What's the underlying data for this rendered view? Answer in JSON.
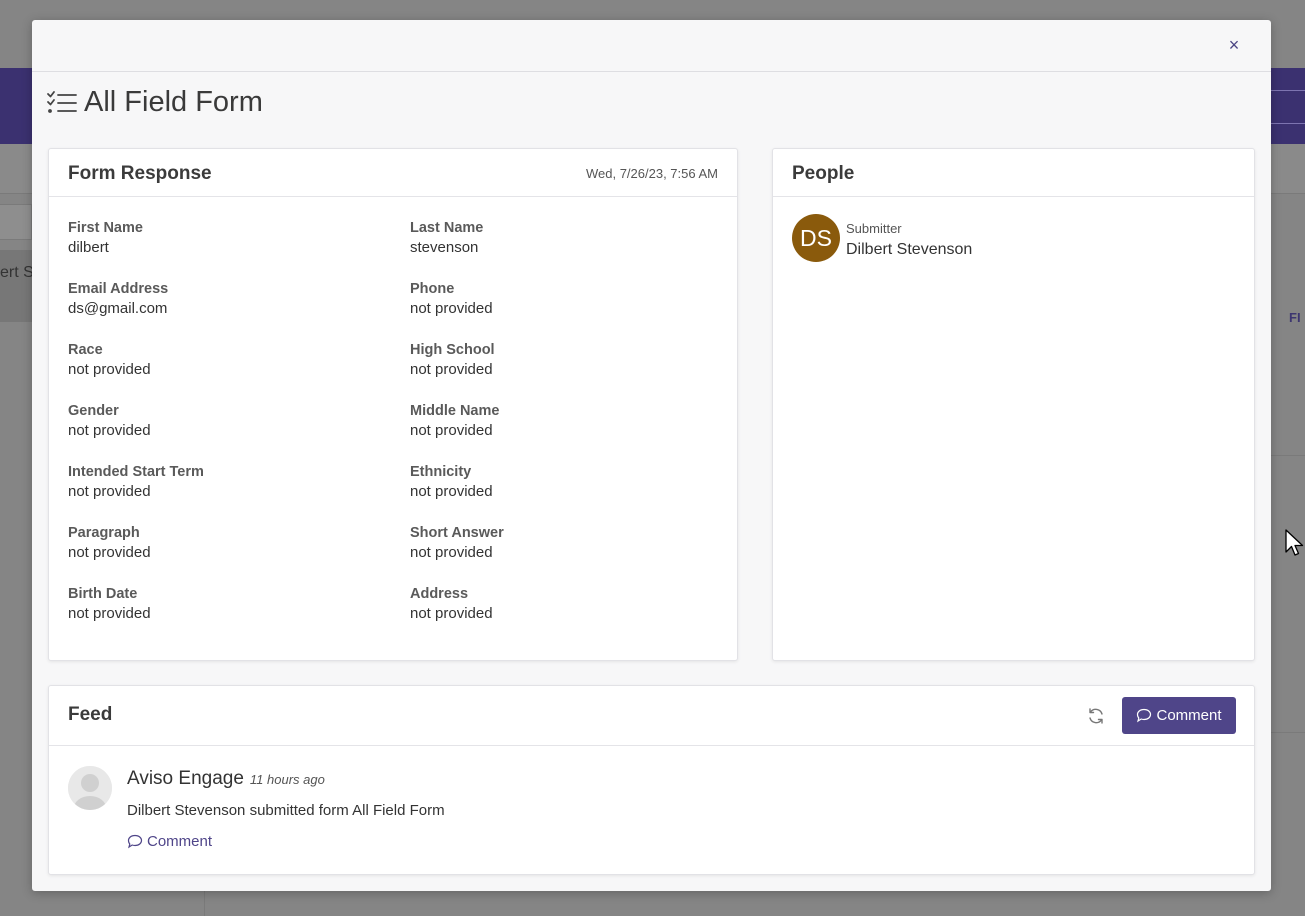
{
  "background": {
    "left_item_text": "ert S",
    "right_fi_text": "FI"
  },
  "modal": {
    "close_label": "×",
    "title": "All Field Form"
  },
  "form_response": {
    "title": "Form Response",
    "date": "Wed, 7/26/23, 7:56 AM",
    "fields": [
      {
        "label": "First Name",
        "value": "dilbert"
      },
      {
        "label": "Last Name",
        "value": "stevenson"
      },
      {
        "label": "Email Address",
        "value": "ds@gmail.com"
      },
      {
        "label": "Phone",
        "value": "not provided"
      },
      {
        "label": "Race",
        "value": "not provided"
      },
      {
        "label": "High School",
        "value": "not provided"
      },
      {
        "label": "Gender",
        "value": "not provided"
      },
      {
        "label": "Middle Name",
        "value": "not provided"
      },
      {
        "label": "Intended Start Term",
        "value": "not provided"
      },
      {
        "label": "Ethnicity",
        "value": "not provided"
      },
      {
        "label": "Paragraph",
        "value": "not provided"
      },
      {
        "label": "Short Answer",
        "value": "not provided"
      },
      {
        "label": "Birth Date",
        "value": "not provided"
      },
      {
        "label": "Address",
        "value": "not provided"
      }
    ]
  },
  "people": {
    "title": "People",
    "person": {
      "initials": "DS",
      "role": "Submitter",
      "name": "Dilbert Stevenson",
      "avatar_color": "#8a5a0c"
    }
  },
  "feed": {
    "title": "Feed",
    "comment_button_label": "Comment",
    "entries": [
      {
        "author": "Aviso Engage",
        "time": "11 hours ago",
        "text": "Dilbert Stevenson submitted form All Field Form",
        "comment_link_label": "Comment"
      }
    ]
  },
  "colors": {
    "accent": "#4f4589",
    "header_bg": "#3b3170"
  }
}
